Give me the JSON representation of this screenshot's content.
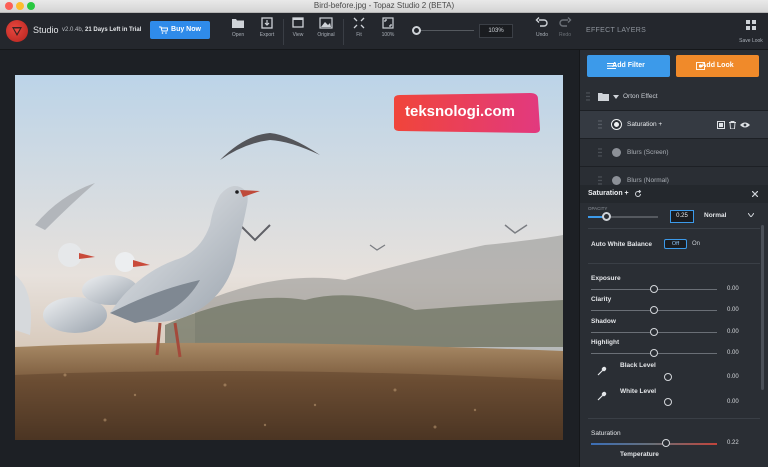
{
  "window": {
    "title": "Bird-before.jpg - Topaz Studio 2 (BETA)"
  },
  "toolbar": {
    "brand": "Studio",
    "version": "v2.0.4b,",
    "trial": "21 Days Left in Trial",
    "buy_label": "Buy Now",
    "tools": [
      "Open",
      "Export",
      "View",
      "Original",
      "Fit",
      "100%"
    ],
    "zoom_value": "103%",
    "undo_label": "Undo",
    "redo_label": "Redo",
    "save_look_label": "Save Look"
  },
  "panel": {
    "header": "EFFECT LAYERS",
    "add_filter": "Add Filter",
    "add_look": "Add Look",
    "layers": [
      {
        "name": "Orton Effect",
        "type": "group"
      },
      {
        "name": "Saturation +",
        "selected": true
      },
      {
        "name": "Blurs (Screen)"
      },
      {
        "name": "Blurs (Normal)"
      }
    ],
    "settings": {
      "title": "Saturation +",
      "opacity_label": "OPACITY",
      "opacity_value": "0.25",
      "opacity_fraction": 0.25,
      "blend_mode": "Normal",
      "awb_label": "Auto White Balance",
      "awb_off": "Off",
      "awb_on": "On",
      "adjustments": [
        {
          "label": "Exposure",
          "value": "0.00"
        },
        {
          "label": "Clarity",
          "value": "0.00"
        },
        {
          "label": "Shadow",
          "value": "0.00"
        },
        {
          "label": "Highlight",
          "value": "0.00"
        }
      ],
      "levels": [
        {
          "label": "Black Level",
          "value": "0.00"
        },
        {
          "label": "White Level",
          "value": "0.00"
        }
      ],
      "saturation_label": "Saturation",
      "saturation_value": "0.22",
      "temperature_label": "Temperature"
    }
  },
  "watermark_text": "teksnologi.com",
  "colors": {
    "accent_blue": "#3c9aea",
    "accent_orange": "#f08a2a",
    "brand_red": "#d83a33"
  }
}
